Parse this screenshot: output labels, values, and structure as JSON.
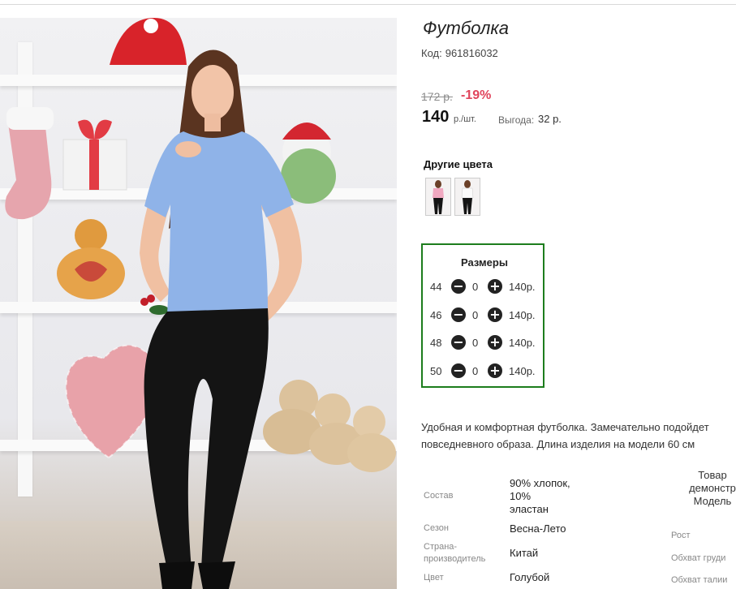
{
  "product": {
    "title": "Футболка",
    "code_label": "Код:",
    "code": "961816032",
    "old_price": "172 р.",
    "discount": "-19%",
    "price": "140",
    "price_unit": "р./шт.",
    "savings_label": "Выгода:",
    "savings_value": "32 р."
  },
  "colors": {
    "heading": "Другие цвета",
    "swatches": [
      {
        "name": "pink",
        "color": "#f0a8c0"
      },
      {
        "name": "white",
        "color": "#f6f6f6"
      }
    ]
  },
  "sizes": {
    "title": "Размеры",
    "rows": [
      {
        "size": "44",
        "qty": "0",
        "price": "140р."
      },
      {
        "size": "46",
        "qty": "0",
        "price": "140р."
      },
      {
        "size": "48",
        "qty": "0",
        "price": "140р."
      },
      {
        "size": "50",
        "qty": "0",
        "price": "140р."
      }
    ],
    "minus_icon": "minus-circle-icon",
    "plus_icon": "plus-circle-icon",
    "border_color": "#1d7d1d"
  },
  "description": {
    "line1": "Удобная и комфортная футболка. Замечательно подойдет",
    "line2": "повседневного образа. Длина изделия на модели 60 см"
  },
  "specs": [
    {
      "label": "Состав",
      "value": "90% хлопок,\n10%\nэластан"
    },
    {
      "label": "Сезон",
      "value": "Весна-Лето"
    },
    {
      "label": "Страна-\nпроизводитель",
      "value": "Китай"
    },
    {
      "label": "Цвет",
      "value": "Голубой"
    }
  ],
  "model": {
    "heading_lines": [
      "Товар",
      "демонстр",
      "Модель"
    ],
    "labels": [
      "Рост",
      "Обхват груди",
      "Обхват талии"
    ]
  },
  "theme": {
    "discount_color": "#e0445c",
    "shirt_color": "#8fb3e8",
    "cta_color": "#c7e85a"
  }
}
